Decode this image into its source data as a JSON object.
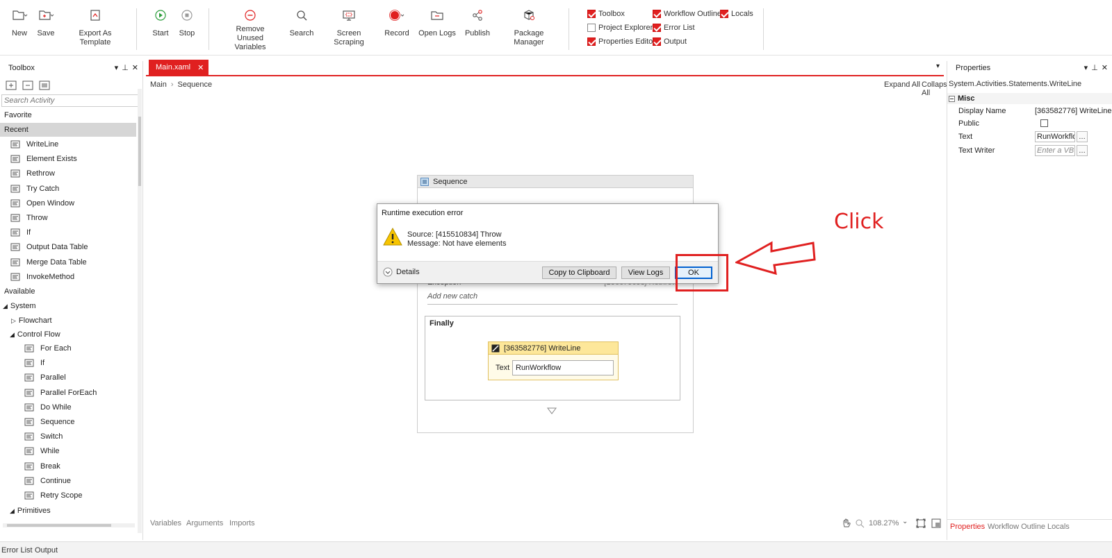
{
  "ribbon": {
    "new": "New",
    "save": "Save",
    "export_template": "Export As Template",
    "start": "Start",
    "stop": "Stop",
    "remove_unused_line1": "Remove Unused",
    "remove_unused_line2": "Variables",
    "search": "Search",
    "screen_scraping": "Screen Scraping",
    "record": "Record",
    "open_logs": "Open Logs",
    "publish": "Publish",
    "package_manager": "Package Manager",
    "panels": [
      {
        "label": "Toolbox",
        "checked": true
      },
      {
        "label": "Workflow Outline",
        "checked": true
      },
      {
        "label": "Locals",
        "checked": true
      },
      {
        "label": "Project Explorer",
        "checked": false
      },
      {
        "label": "Error List",
        "checked": true
      },
      {
        "label": "Properties Editor",
        "checked": true
      },
      {
        "label": "Output",
        "checked": true
      }
    ]
  },
  "toolbox": {
    "title": "Toolbox",
    "search_placeholder": "Search Activity",
    "favorite": "Favorite",
    "recent": "Recent",
    "recent_items": [
      "WriteLine",
      "Element Exists",
      "Rethrow",
      "Try Catch",
      "Open Window",
      "Throw",
      "If",
      "Output Data Table",
      "Merge Data Table",
      "InvokeMethod"
    ],
    "available": "Available",
    "system": "System",
    "flowchart": "Flowchart",
    "control_flow": "Control Flow",
    "control_flow_items": [
      "For Each",
      "If",
      "Parallel",
      "Parallel ForEach",
      "Do While",
      "Sequence",
      "Switch",
      "While",
      "Break",
      "Continue",
      "Retry Scope"
    ],
    "primitives": "Primitives"
  },
  "editor": {
    "tab": "Main.xaml",
    "breadcrumb": [
      "Main",
      "Sequence"
    ],
    "expand_all": "Expand All",
    "collapse_all": "Collapse All",
    "sequence_title": "Sequence",
    "exception_label": "Exception",
    "exception_value": "[106670693] Rethrow",
    "add_catch": "Add new catch",
    "finally_label": "Finally",
    "writeline_title": "[363582776] WriteLine",
    "writeline_text_label": "Text",
    "writeline_text_value": "RunWorkflow",
    "bottom_tabs": [
      "Variables",
      "Arguments",
      "Imports"
    ],
    "zoom": "108.27%"
  },
  "dialog": {
    "title": "Runtime execution error",
    "source": "Source: [415510834] Throw",
    "message": "Message: Not have elements",
    "details": "Details",
    "copy_button": "Copy to Clipboard",
    "view_logs_button": "View Logs",
    "ok_button": "OK"
  },
  "annotation": {
    "text": "Click",
    "color": "#e02020"
  },
  "properties": {
    "title": "Properties",
    "type_name": "System.Activities.Statements.WriteLine",
    "category": "Misc",
    "rows": [
      {
        "name": "Display Name",
        "value": "[363582776] WriteLine"
      },
      {
        "name": "Public",
        "value": ""
      },
      {
        "name": "Text",
        "value": "RunWorkflow"
      },
      {
        "name": "Text Writer",
        "value": "Enter a VB expression"
      }
    ],
    "bottom_tabs": [
      "Properties",
      "Workflow Outline",
      "Locals"
    ]
  },
  "status_tabs": [
    "Error List",
    "Output"
  ],
  "colors": {
    "accent": "#e02020"
  }
}
